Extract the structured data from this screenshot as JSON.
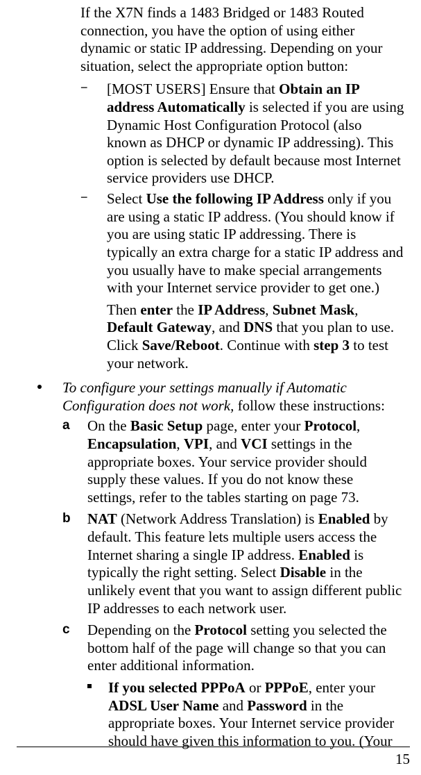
{
  "intro": {
    "p1a": "If the X7N finds a 1483 Bridged or 1483 Routed connection, you have the option of using either dynamic or static IP addressing. Depending on your situation, select the appropriate option button:"
  },
  "dash": {
    "i1": {
      "pre": "[MOST USERS] Ensure that ",
      "b1": "Obtain an IP address Automatically",
      "post": " is selected if you are using Dynamic Host Configuration Protocol (also known as DHCP or dynamic IP addressing). This option is selected by default because most Internet service providers use DHCP."
    },
    "i2": {
      "pre": "Select ",
      "b1": "Use the following IP Address",
      "post": " only if you are using a static IP address. (You should know if you are using static IP addressing. There is typically an extra charge for a static IP address and you usually have to make special arrangements with your Internet service provider to get one.)",
      "p2": {
        "t1": "Then ",
        "b1": "enter",
        "t2": " the ",
        "b2": "IP Address",
        "t3": ", ",
        "b3": "Subnet Mask",
        "t4": ", ",
        "b4": "Default Gateway",
        "t5": ", and ",
        "b5": "DNS",
        "t6": " that you plan to use. Click ",
        "b6": "Save/Reboot",
        "t7": ". Continue with ",
        "b7": "step 3",
        "t8": " to test your network."
      }
    }
  },
  "config": {
    "em": "To configure your settings manually if Automatic Configuration does not work,",
    "tail": " follow these instructions:"
  },
  "letters": {
    "a": {
      "marker": "a",
      "t1": "On the ",
      "b1": "Basic Setup",
      "t2": " page, enter your ",
      "b2": "Protocol",
      "t3": ", ",
      "b3": "Encapsulation",
      "t4": ", ",
      "b4": "VPI",
      "t5": ", and ",
      "b5": "VCI",
      "t6": " settings in the appropriate boxes. Your service provider should supply these values. If you do not know these settings, refer to the tables starting on page 73."
    },
    "b": {
      "marker": "b",
      "b1": "NAT",
      "t1": " (Network Address Translation) is ",
      "b2": "Enabled",
      "t2": " by default. This feature lets multiple users access the Internet sharing a single IP address. ",
      "b3": "Enabled",
      "t3": " is typically the right setting. Select ",
      "b4": "Disable",
      "t4": " in the unlikely event that you want to assign different public IP addresses to each network user."
    },
    "c": {
      "marker": "c",
      "t1": "Depending on the ",
      "b1": "Protocol",
      "t2": " setting you selected the bottom half of the page will change so that you can enter additional information."
    }
  },
  "square": {
    "i1": {
      "b1": "If you selected PPPoA",
      "t1": " or ",
      "b2": "PPPoE",
      "t2": ", enter your ",
      "b3": "ADSL User Name",
      "t3": " and ",
      "b4": "Password",
      "t4": " in the appropriate boxes. Your Internet service provider should have given this information to you. (Your"
    }
  },
  "pagenum": "15"
}
